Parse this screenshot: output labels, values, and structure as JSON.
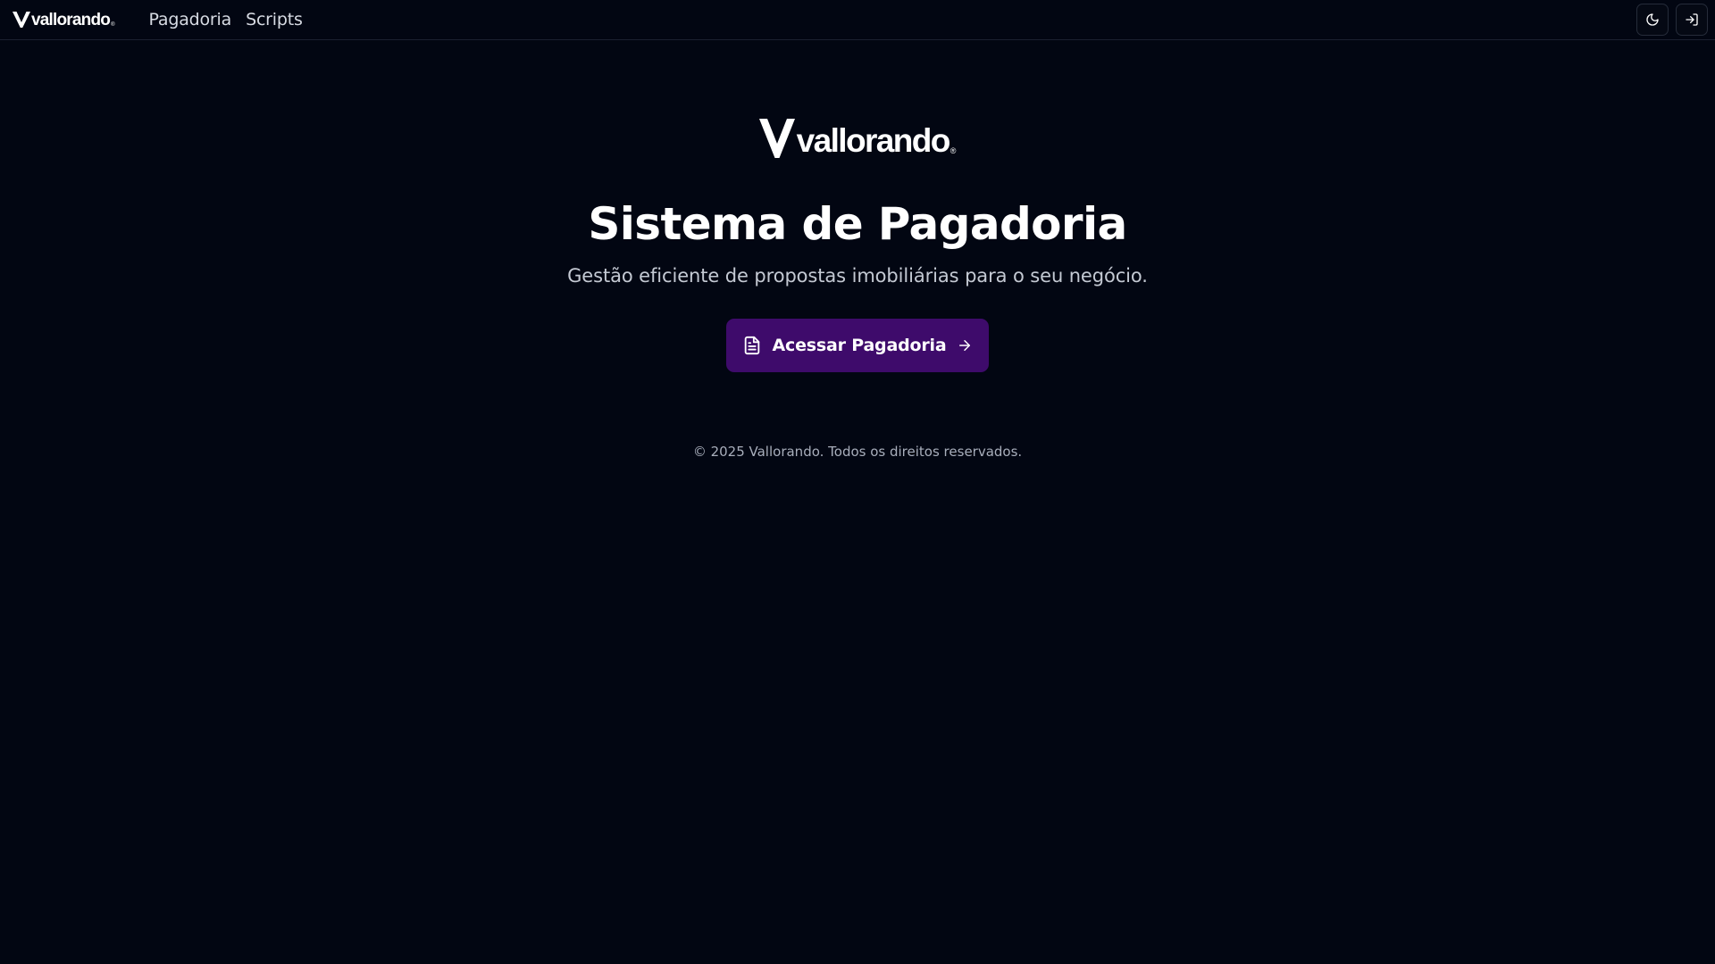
{
  "header": {
    "brand": {
      "wordmark": "vallorando",
      "reg": "®"
    },
    "nav": [
      {
        "label": "Pagadoria"
      },
      {
        "label": "Scripts"
      }
    ],
    "actions": [
      {
        "icon": "moon-icon"
      },
      {
        "icon": "log-in-icon"
      }
    ]
  },
  "hero": {
    "brand": {
      "wordmark": "vallorando",
      "reg": "®"
    },
    "title": "Sistema de Pagadoria",
    "subtitle": "Gestão eficiente de propostas imobiliárias para o seu negócio.",
    "cta": {
      "label": "Acessar Pagadoria",
      "leading_icon": "file-text-icon",
      "trailing_icon": "arrow-right-icon"
    }
  },
  "footer": {
    "copyright": "© 2025 Vallorando. Todos os direitos reservados."
  },
  "colors": {
    "background": "#020612",
    "accent": "#3e0b6b",
    "border": "#1b2030",
    "text_muted": "#c4c9d3"
  }
}
